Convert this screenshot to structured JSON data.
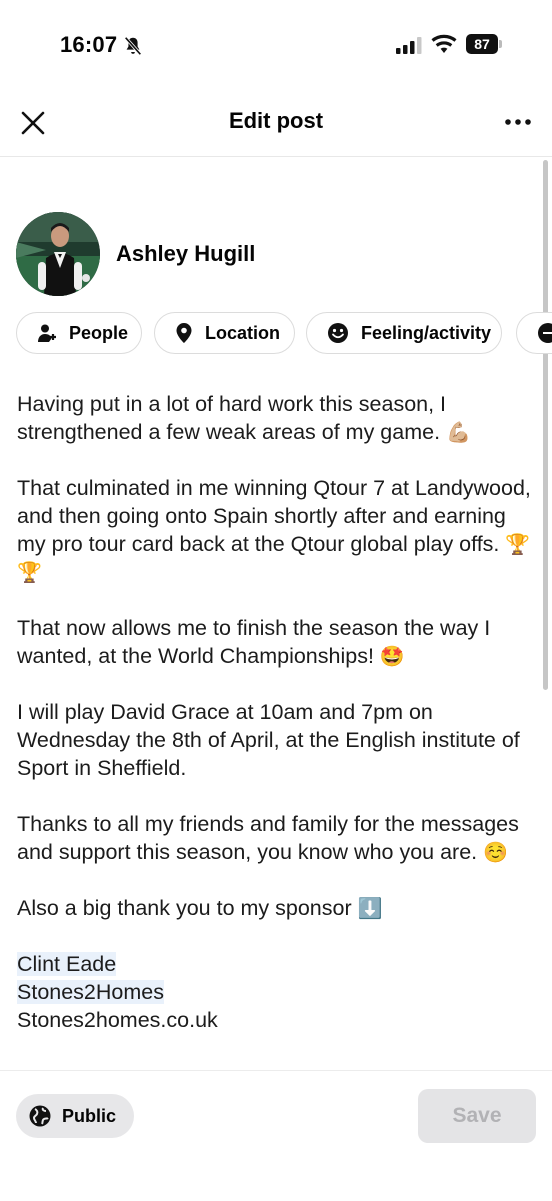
{
  "status_bar": {
    "time": "16:07",
    "battery": "87"
  },
  "header": {
    "title": "Edit post"
  },
  "author": {
    "name": "Ashley Hugill"
  },
  "chips": {
    "people": "People",
    "location": "Location",
    "feeling": "Feeling/activity"
  },
  "post": {
    "p1": "Having put in a lot of hard work this season, I strengthened a few weak areas of my game.",
    "p1_emoji": "💪🏼",
    "p2": "That culminated in me winning Qtour 7 at Landywood, and then going onto Spain shortly after and earning my pro tour card back at the Qtour global play offs.",
    "p2_emoji": "🏆🏆",
    "p3": "That now allows me to finish the season the way I wanted, at the World Championships!",
    "p3_emoji": "🤩",
    "p4": "I will play David Grace at 10am and 7pm on Wednesday the 8th of April, at the English institute of Sport in Sheffield.",
    "p5": "Thanks to all my friends and family for the messages and support this season, you know who you are.",
    "p5_emoji": "☺️",
    "p6": "Also a big thank you to my sponsor",
    "p6_emoji": "⬇️",
    "mention1": "Clint Eade",
    "mention2": "Stones2Homes",
    "link": "Stones2homes.co.uk"
  },
  "footer": {
    "audience": "Public",
    "save": "Save"
  },
  "colors": {
    "mention_bg": "#e9f1fb",
    "save_disabled_bg": "#e4e4e6",
    "save_disabled_text": "#b2b2b5"
  },
  "icons": [
    "bell-off-icon",
    "signal-icon",
    "wifi-icon",
    "battery-icon",
    "close-icon",
    "more-icon",
    "people-icon",
    "location-pin-icon",
    "smiley-icon",
    "globe-icon"
  ]
}
